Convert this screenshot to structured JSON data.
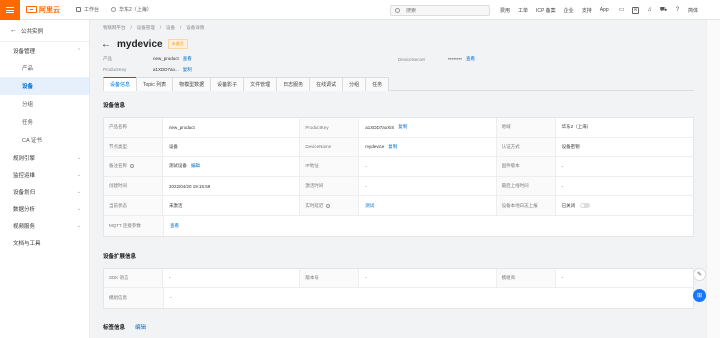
{
  "header": {
    "brand": "阿里云",
    "workspace": "工作台",
    "region": "华东2（上海）",
    "search_placeholder": "搜索",
    "nav": [
      "费用",
      "工单",
      "ICP 备案",
      "企业",
      "支持",
      "App"
    ],
    "language": "简体"
  },
  "sidebar": {
    "back_label": "公共实例",
    "groups": [
      {
        "label": "设备管理",
        "chevron": "⌃",
        "items": [
          {
            "label": "产品",
            "active": false
          },
          {
            "label": "设备",
            "active": true
          },
          {
            "label": "分组",
            "active": false
          },
          {
            "label": "任务",
            "active": false
          },
          {
            "label": "CA 证书",
            "active": false
          }
        ]
      },
      {
        "label": "规则引擎",
        "chevron": "⌄"
      },
      {
        "label": "监控运维",
        "chevron": "⌄"
      },
      {
        "label": "设备划归",
        "chevron": "⌄"
      },
      {
        "label": "数据分析",
        "chevron": "⌄"
      },
      {
        "label": "视频服务",
        "chevron": "⌄"
      },
      {
        "label": "文档与工具",
        "chevron": ""
      }
    ]
  },
  "breadcrumb": [
    "物联网平台",
    "设备管理",
    "设备",
    "设备详情"
  ],
  "device": {
    "name": "mydevice",
    "status_badge": "未激活",
    "product_label": "产品",
    "product_value": "new_product",
    "view": "查看",
    "productkey_label": "ProductKey",
    "productkey_value": "a1XDD7ao...",
    "copy": "复制",
    "secret_label": "DeviceSecret",
    "secret_value": "********",
    "secret_view": "查看"
  },
  "tabs": [
    {
      "label": "设备信息",
      "active": true
    },
    {
      "label": "Topic 列表",
      "active": false
    },
    {
      "label": "物模型数据",
      "active": false
    },
    {
      "label": "设备影子",
      "active": false
    },
    {
      "label": "文件管理",
      "active": false
    },
    {
      "label": "日志服务",
      "active": false
    },
    {
      "label": "在线调试",
      "active": false
    },
    {
      "label": "分组",
      "active": false
    },
    {
      "label": "任务",
      "active": false
    }
  ],
  "device_info": {
    "title": "设备信息",
    "rows": [
      [
        [
          "产品名称",
          "new_product"
        ],
        [
          "ProductKey",
          "a1XDD7aoXiS"
        ],
        [
          "地域",
          "华东2（上海）"
        ]
      ],
      [
        [
          "节点类型",
          "设备"
        ],
        [
          "DeviceName",
          "mydevice"
        ],
        [
          "认证方式",
          "设备密钥"
        ]
      ],
      [
        [
          "备注名称",
          "测试设备"
        ],
        [
          "IP地址",
          "-"
        ],
        [
          "固件版本",
          "-"
        ]
      ],
      [
        [
          "创建时间",
          "2022/04/20 19:15:59"
        ],
        [
          "激活时间",
          "-"
        ],
        [
          "最后上线时间",
          "-"
        ]
      ],
      [
        [
          "当前状态",
          "未激活"
        ],
        [
          "实时延迟",
          "测试"
        ],
        [
          "设备本地日志上报",
          "已关闭"
        ]
      ],
      [
        [
          "MQTT 连接参数",
          "查看"
        ]
      ]
    ],
    "edit": "编辑",
    "copy": "复制"
  },
  "ext_info": {
    "title": "设备扩展信息",
    "rows": [
      [
        [
          "SDK 语言",
          "-"
        ],
        [
          "版本号",
          "-"
        ],
        [
          "模组商",
          "-"
        ]
      ],
      [
        [
          "模组信息",
          "-"
        ]
      ]
    ]
  },
  "next_section": {
    "title": "标签信息",
    "edit": "编辑"
  },
  "colors": {
    "brand": "#ff6a00",
    "link": "#0070cc",
    "badge": "#ff9900"
  }
}
